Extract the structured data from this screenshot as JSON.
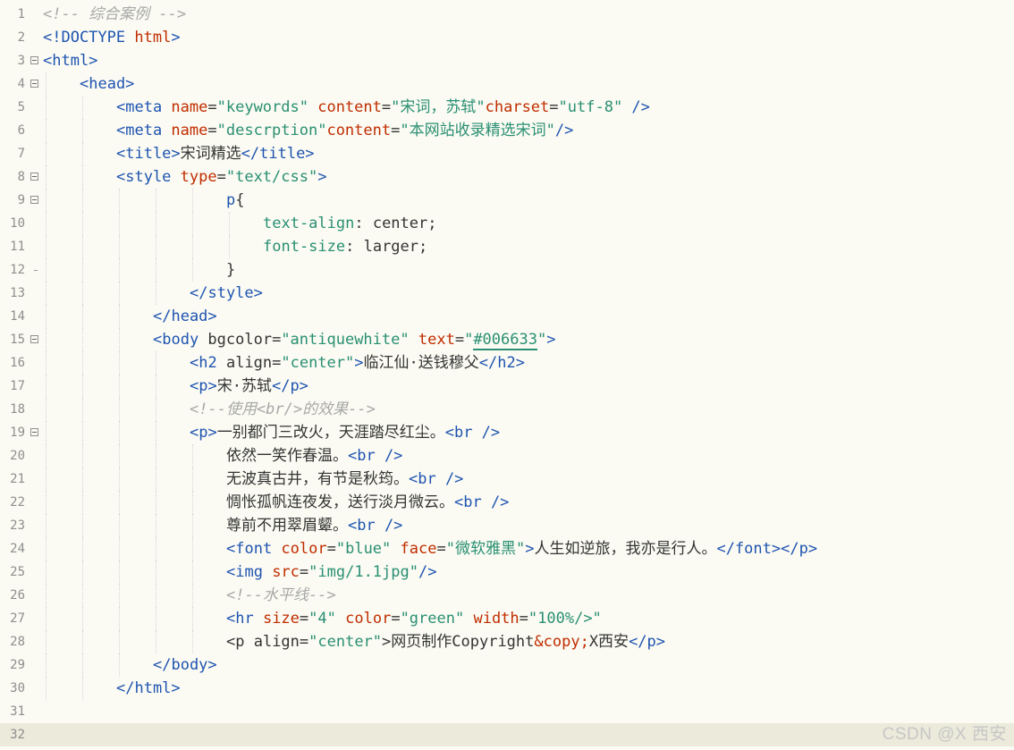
{
  "editor": {
    "lines": [
      {
        "n": "1",
        "fold": false,
        "segments": [
          {
            "c": "c",
            "t": "<!-- 综合案例 -->"
          }
        ]
      },
      {
        "n": "2",
        "fold": false,
        "segments": [
          {
            "c": "t",
            "t": "<!DOCTYPE "
          },
          {
            "c": "a",
            "t": "html"
          },
          {
            "c": "t",
            "t": ">"
          }
        ]
      },
      {
        "n": "3",
        "fold": true,
        "segments": [
          {
            "c": "t",
            "t": "<html>"
          }
        ]
      },
      {
        "n": "4",
        "fold": true,
        "indent": 4,
        "segments": [
          {
            "c": "t",
            "t": "<head>"
          }
        ]
      },
      {
        "n": "5",
        "fold": false,
        "indent": 8,
        "segments": [
          {
            "c": "t",
            "t": "<meta "
          },
          {
            "c": "a",
            "t": "name"
          },
          {
            "c": "x",
            "t": "="
          },
          {
            "c": "v",
            "t": "\"keywords\""
          },
          {
            "c": "x",
            "t": " "
          },
          {
            "c": "a",
            "t": "content"
          },
          {
            "c": "x",
            "t": "="
          },
          {
            "c": "v",
            "t": "\"宋词，苏轼\""
          },
          {
            "c": "a",
            "t": "charset"
          },
          {
            "c": "x",
            "t": "="
          },
          {
            "c": "v",
            "t": "\"utf-8\""
          },
          {
            "c": "t",
            "t": " />"
          }
        ]
      },
      {
        "n": "6",
        "fold": false,
        "indent": 8,
        "segments": [
          {
            "c": "t",
            "t": "<meta "
          },
          {
            "c": "a",
            "t": "name"
          },
          {
            "c": "x",
            "t": "="
          },
          {
            "c": "v",
            "t": "\"descrption\""
          },
          {
            "c": "a",
            "t": "content"
          },
          {
            "c": "x",
            "t": "="
          },
          {
            "c": "v",
            "t": "\"本网站收录精选宋词\""
          },
          {
            "c": "t",
            "t": "/>"
          }
        ]
      },
      {
        "n": "7",
        "fold": false,
        "indent": 8,
        "segments": [
          {
            "c": "t",
            "t": "<title>"
          },
          {
            "c": "x",
            "t": "宋词精选"
          },
          {
            "c": "t",
            "t": "</title>"
          }
        ]
      },
      {
        "n": "8",
        "fold": true,
        "indent": 8,
        "segments": [
          {
            "c": "t",
            "t": "<style "
          },
          {
            "c": "a",
            "t": "type"
          },
          {
            "c": "x",
            "t": "="
          },
          {
            "c": "v",
            "t": "\"text/css\""
          },
          {
            "c": "t",
            "t": ">"
          }
        ]
      },
      {
        "n": "9",
        "fold": true,
        "indent": 20,
        "segments": [
          {
            "c": "t",
            "t": "p"
          },
          {
            "c": "x",
            "t": "{"
          }
        ]
      },
      {
        "n": "10",
        "fold": false,
        "indent": 24,
        "segments": [
          {
            "c": "p",
            "t": "text-align"
          },
          {
            "c": "x",
            "t": ": center;"
          }
        ]
      },
      {
        "n": "11",
        "fold": false,
        "indent": 24,
        "segments": [
          {
            "c": "p",
            "t": "font-size"
          },
          {
            "c": "x",
            "t": ": larger;"
          }
        ]
      },
      {
        "n": "12",
        "fold": false,
        "tick": true,
        "indent": 20,
        "segments": [
          {
            "c": "x",
            "t": "}"
          }
        ]
      },
      {
        "n": "13",
        "fold": false,
        "indent": 16,
        "segments": [
          {
            "c": "t",
            "t": "</style>"
          }
        ]
      },
      {
        "n": "14",
        "fold": false,
        "indent": 12,
        "segments": [
          {
            "c": "t",
            "t": "</head>"
          }
        ]
      },
      {
        "n": "15",
        "fold": true,
        "indent": 12,
        "segments": [
          {
            "c": "t",
            "t": "<body "
          },
          {
            "c": "x",
            "t": "bgcolor="
          },
          {
            "c": "v",
            "t": "\"antiquewhite\""
          },
          {
            "c": "x",
            "t": " "
          },
          {
            "c": "a",
            "t": "text"
          },
          {
            "c": "x",
            "t": "="
          },
          {
            "c": "v",
            "t": "\""
          },
          {
            "c": "v u",
            "t": "#006633"
          },
          {
            "c": "v",
            "t": "\""
          },
          {
            "c": "t",
            "t": ">"
          }
        ]
      },
      {
        "n": "16",
        "fold": false,
        "indent": 16,
        "segments": [
          {
            "c": "t",
            "t": "<h2 "
          },
          {
            "c": "x",
            "t": "align="
          },
          {
            "c": "v",
            "t": "\"center\""
          },
          {
            "c": "t",
            "t": ">"
          },
          {
            "c": "x",
            "t": "临江仙·送钱穆父"
          },
          {
            "c": "t",
            "t": "</h2>"
          }
        ]
      },
      {
        "n": "17",
        "fold": false,
        "indent": 16,
        "segments": [
          {
            "c": "t",
            "t": "<p>"
          },
          {
            "c": "x",
            "t": "宋·苏轼"
          },
          {
            "c": "t",
            "t": "</p>"
          }
        ]
      },
      {
        "n": "18",
        "fold": false,
        "indent": 16,
        "segments": [
          {
            "c": "c",
            "t": "<!--使用<br/>的效果-->"
          }
        ]
      },
      {
        "n": "19",
        "fold": true,
        "indent": 16,
        "segments": [
          {
            "c": "t",
            "t": "<p>"
          },
          {
            "c": "x",
            "t": "一别都门三改火，天涯踏尽红尘。"
          },
          {
            "c": "t",
            "t": "<br />"
          }
        ]
      },
      {
        "n": "20",
        "fold": false,
        "indent": 20,
        "segments": [
          {
            "c": "x",
            "t": "依然一笑作春温。"
          },
          {
            "c": "t",
            "t": "<br />"
          }
        ]
      },
      {
        "n": "21",
        "fold": false,
        "indent": 20,
        "segments": [
          {
            "c": "x",
            "t": "无波真古井，有节是秋筠。"
          },
          {
            "c": "t",
            "t": "<br />"
          }
        ]
      },
      {
        "n": "22",
        "fold": false,
        "indent": 20,
        "segments": [
          {
            "c": "x",
            "t": "惆怅孤帆连夜发，送行淡月微云。"
          },
          {
            "c": "t",
            "t": "<br />"
          }
        ]
      },
      {
        "n": "23",
        "fold": false,
        "indent": 20,
        "segments": [
          {
            "c": "x",
            "t": "尊前不用翠眉颦。"
          },
          {
            "c": "t",
            "t": "<br />"
          }
        ]
      },
      {
        "n": "24",
        "fold": false,
        "indent": 20,
        "segments": [
          {
            "c": "t",
            "t": "<font "
          },
          {
            "c": "a",
            "t": "color"
          },
          {
            "c": "x",
            "t": "="
          },
          {
            "c": "v",
            "t": "\"blue\""
          },
          {
            "c": "x",
            "t": " "
          },
          {
            "c": "a",
            "t": "face"
          },
          {
            "c": "x",
            "t": "="
          },
          {
            "c": "v",
            "t": "\"微软雅黑\""
          },
          {
            "c": "t",
            "t": ">"
          },
          {
            "c": "x",
            "t": "人生如逆旅，我亦是行人。"
          },
          {
            "c": "t",
            "t": "</font></p>"
          }
        ]
      },
      {
        "n": "25",
        "fold": false,
        "indent": 20,
        "segments": [
          {
            "c": "t",
            "t": "<img "
          },
          {
            "c": "a",
            "t": "src"
          },
          {
            "c": "x",
            "t": "="
          },
          {
            "c": "v",
            "t": "\"img/1.1jpg\""
          },
          {
            "c": "t",
            "t": "/>"
          }
        ]
      },
      {
        "n": "26",
        "fold": false,
        "indent": 20,
        "segments": [
          {
            "c": "c",
            "t": "<!--水平线-->"
          }
        ]
      },
      {
        "n": "27",
        "fold": false,
        "indent": 20,
        "segments": [
          {
            "c": "t",
            "t": "<hr "
          },
          {
            "c": "a",
            "t": "size"
          },
          {
            "c": "x",
            "t": "="
          },
          {
            "c": "v",
            "t": "\"4\""
          },
          {
            "c": "x",
            "t": " "
          },
          {
            "c": "a",
            "t": "color"
          },
          {
            "c": "x",
            "t": "="
          },
          {
            "c": "v",
            "t": "\"green\""
          },
          {
            "c": "x",
            "t": " "
          },
          {
            "c": "a",
            "t": "width"
          },
          {
            "c": "x",
            "t": "="
          },
          {
            "c": "v",
            "t": "\"100%/>\""
          }
        ]
      },
      {
        "n": "28",
        "fold": false,
        "indent": 20,
        "segments": [
          {
            "c": "x",
            "t": "<p "
          },
          {
            "c": "x",
            "t": "align="
          },
          {
            "c": "v",
            "t": "\"center\""
          },
          {
            "c": "x",
            "t": ">网页制作Copyright"
          },
          {
            "c": "a",
            "t": "&copy;"
          },
          {
            "c": "x",
            "t": "X西安"
          },
          {
            "c": "t",
            "t": "</p>"
          }
        ]
      },
      {
        "n": "29",
        "fold": false,
        "indent": 12,
        "segments": [
          {
            "c": "t",
            "t": "</body>"
          }
        ]
      },
      {
        "n": "30",
        "fold": false,
        "indent": 8,
        "segments": [
          {
            "c": "t",
            "t": "</html>"
          }
        ]
      },
      {
        "n": "31",
        "fold": false,
        "segments": []
      },
      {
        "n": "32",
        "fold": false,
        "current": true,
        "segments": []
      }
    ]
  },
  "watermark": "CSDN @X 西安",
  "colors": {
    "tag": "#1f54b0",
    "attr": "#c02d00",
    "value": "#2a8f73",
    "comment": "#a8a8a8",
    "text": "#343434",
    "background": "#fbfbf3"
  }
}
